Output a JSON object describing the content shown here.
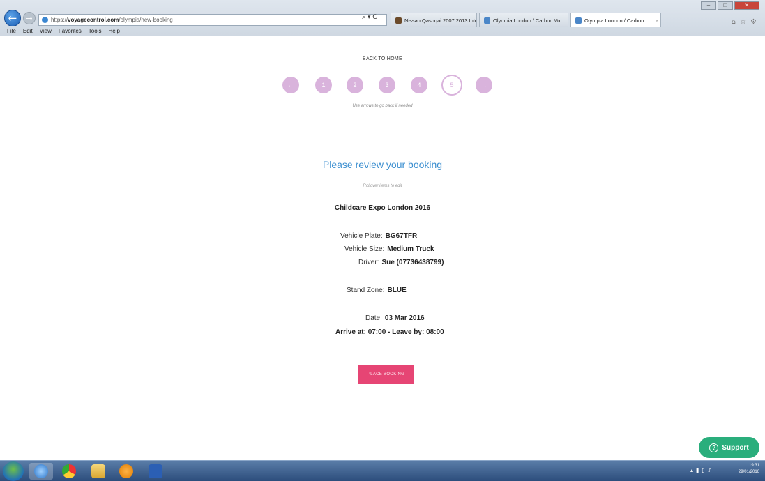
{
  "browser": {
    "address_prefix": "https://",
    "address_domain": "voyagecontrol.com",
    "address_path": "/olympia/new-booking",
    "address_tools": "⌕ ▾ C",
    "tabs": [
      {
        "label": "Nissan Qashqai 2007 2013 Inter"
      },
      {
        "label": "Olympia London / Carbon Vo..."
      },
      {
        "label": "Olympia London / Carbon ...",
        "close": "×"
      }
    ],
    "menu": [
      "File",
      "Edit",
      "View",
      "Favorites",
      "Tools",
      "Help"
    ]
  },
  "page": {
    "back_home": "BACK TO HOME",
    "steps": [
      "1",
      "2",
      "3",
      "4",
      "5"
    ],
    "prev_arrow": "←",
    "next_arrow": "→",
    "step_hint": "Use arrows to go back if needed",
    "title": "Please review your booking",
    "subtitle": "Rollover items to edit",
    "event_name": "Childcare Expo London 2016",
    "vehicle_plate_label": "Vehicle Plate:",
    "vehicle_plate": "BG67TFR",
    "vehicle_size_label": "Vehicle Size:",
    "vehicle_size": "Medium Truck",
    "driver_label": "Driver:",
    "driver": "Sue (07736438799)",
    "stand_zone_label": "Stand Zone:",
    "stand_zone": "BLUE",
    "date_label": "Date:",
    "date": "03 Mar 2016",
    "arrive_label": "Arrive at:",
    "arrive": "07:00",
    "leave_label": "- Leave by:",
    "leave": "08:00",
    "place_booking": "PLACE BOOKING",
    "support": "Support",
    "support_icon": "?"
  },
  "taskbar": {
    "clock_time": "19:31",
    "clock_date": "29/01/2016"
  },
  "colors": {
    "accent_blue": "#3c8fd0",
    "step_purple": "#d9b3dc",
    "booking_pink": "#e64574",
    "support_green": "#2aae7c"
  }
}
